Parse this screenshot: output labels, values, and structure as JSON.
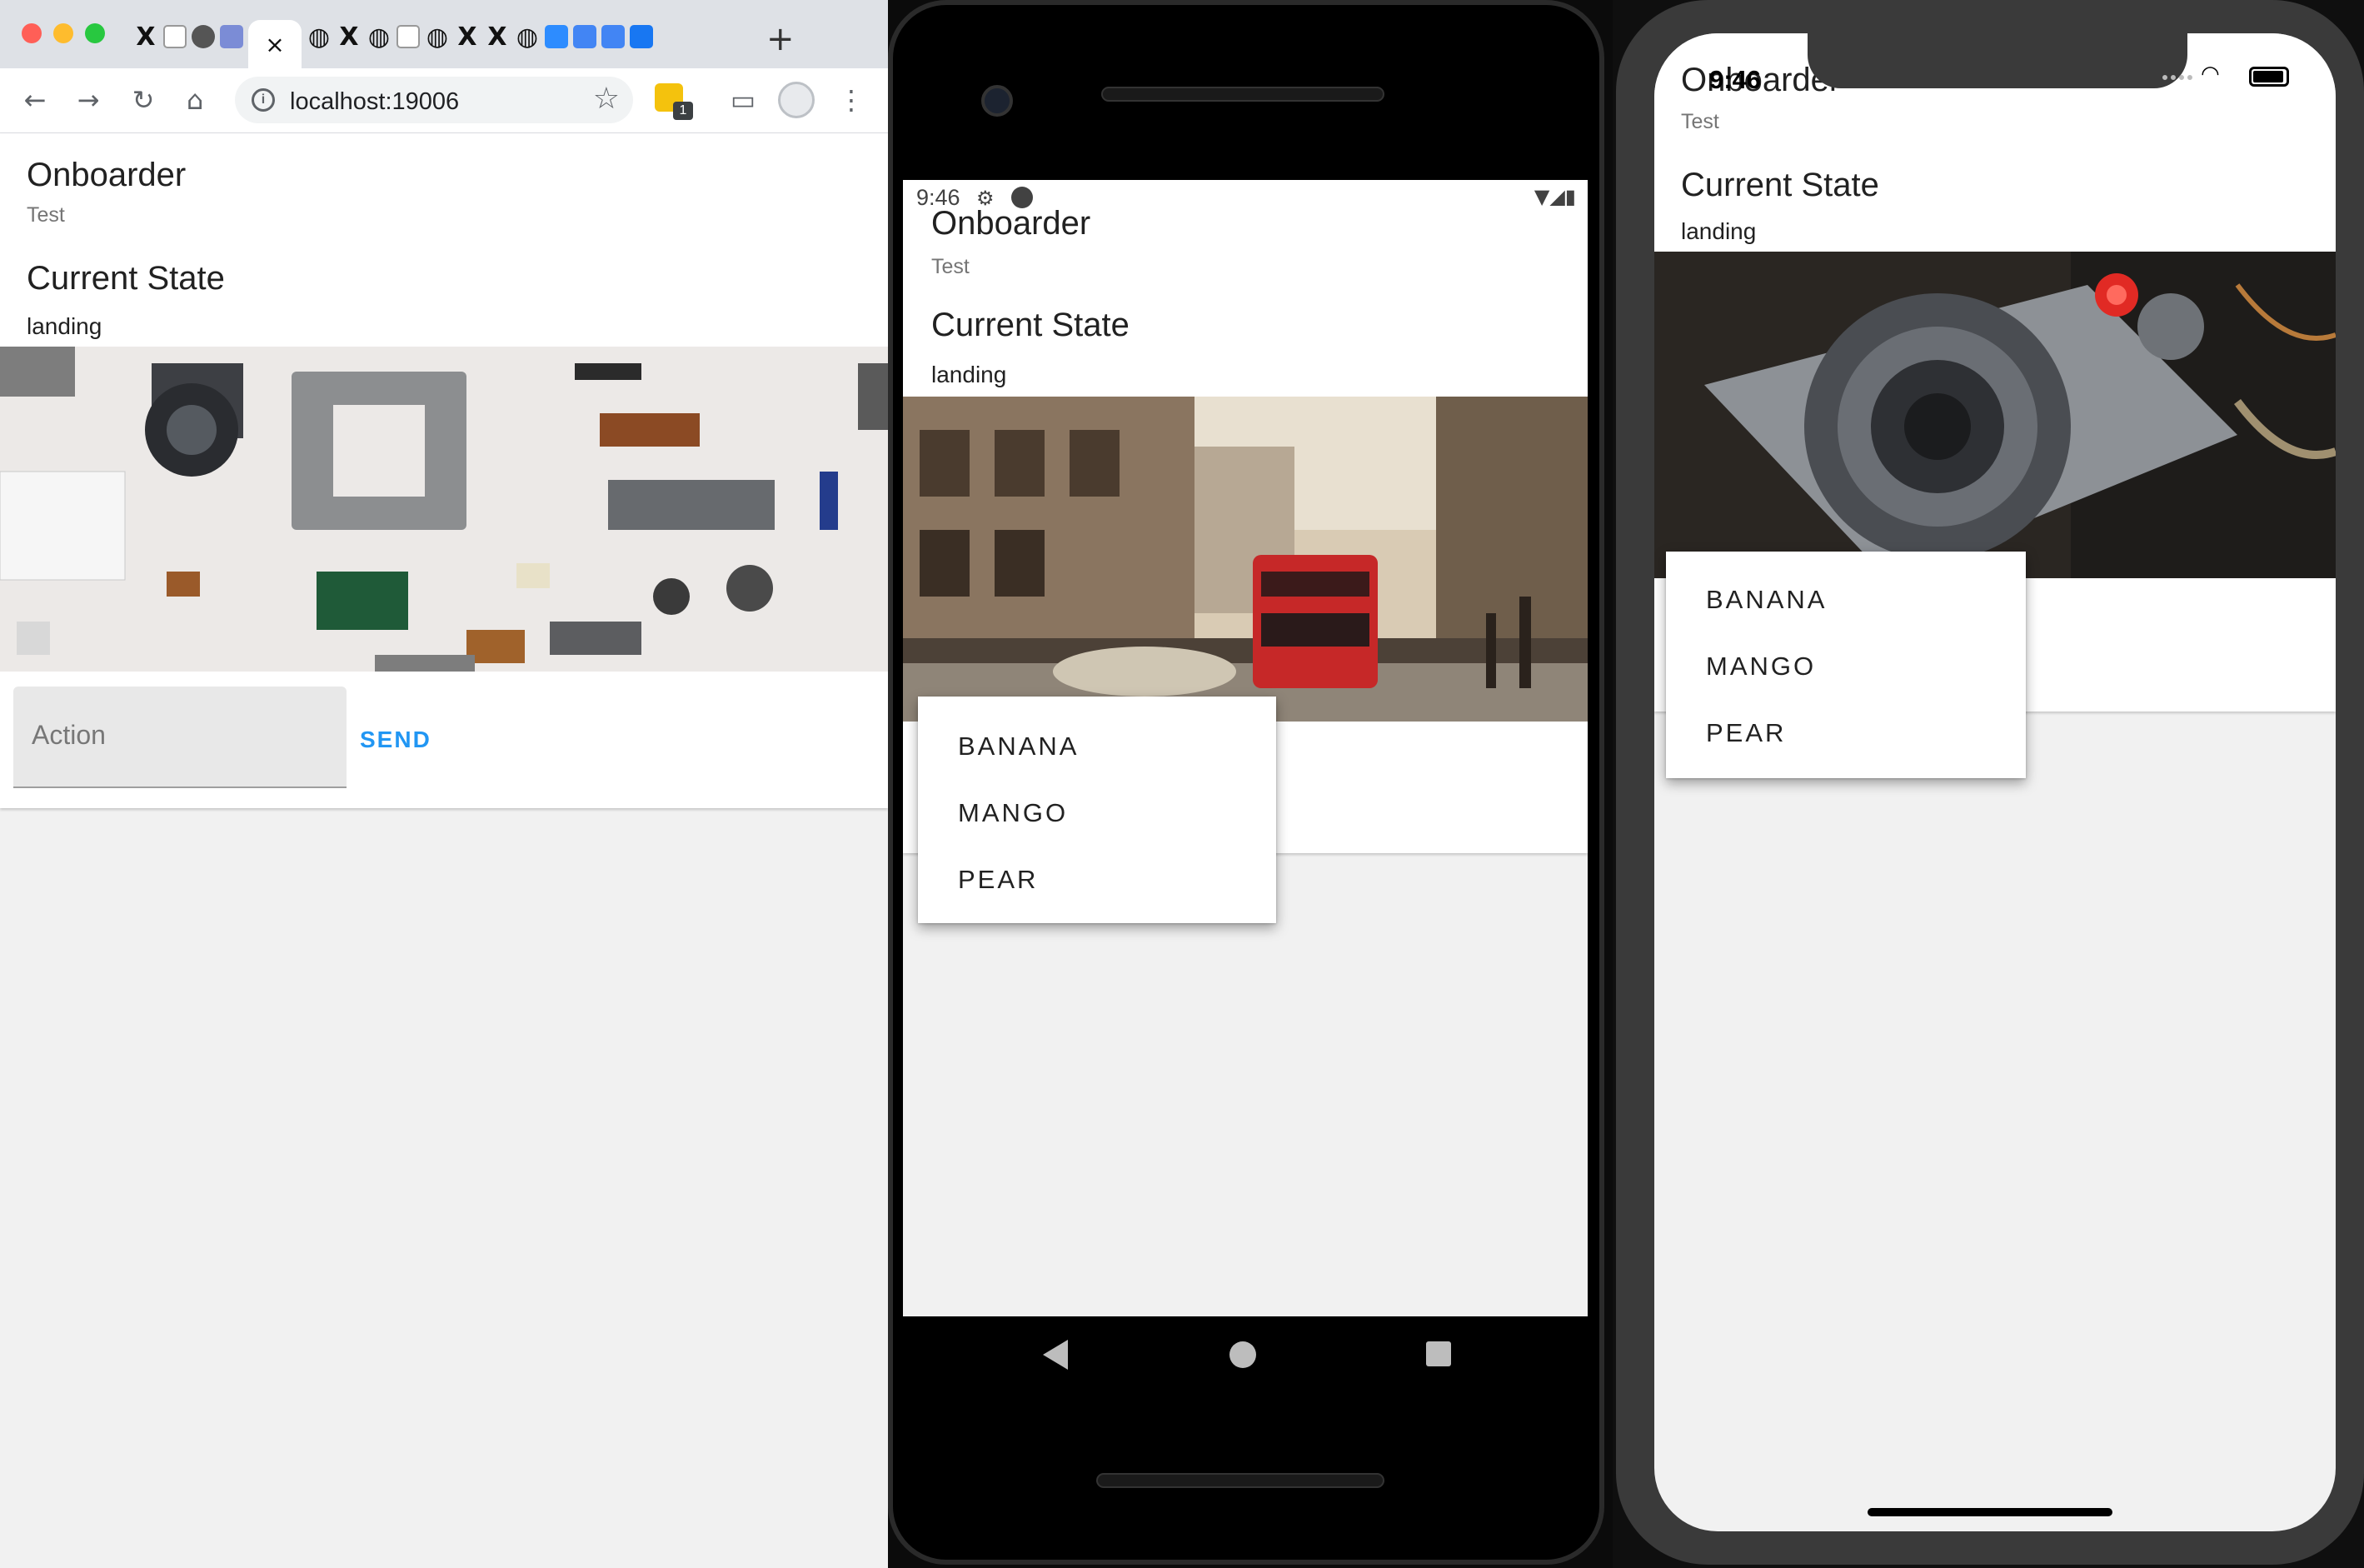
{
  "browser": {
    "url": "localhost:19006",
    "extension_badge": "1",
    "active_tab_close": "×",
    "new_tab": "+"
  },
  "app": {
    "title": "Onboarder",
    "subtitle": "Test",
    "section_title": "Current State",
    "state_value": "landing",
    "action_placeholder": "Action",
    "send_label": "SEND",
    "send_clipped": "END"
  },
  "menu": {
    "items": [
      "BANANA",
      "MANGO",
      "PEAR"
    ]
  },
  "android": {
    "status_time": "9:46"
  },
  "ios": {
    "status_time": "9:46"
  },
  "colors": {
    "accent": "#2196f3",
    "page_bg": "#f1f1f1",
    "bus_red": "#c62828"
  },
  "icons": {
    "back": "arrow-left-icon",
    "forward": "arrow-right-icon",
    "reload": "reload-icon",
    "home": "home-icon",
    "info": "info-icon",
    "bookmark": "star-icon",
    "cast": "cast-icon",
    "menu": "more-vert-icon"
  }
}
